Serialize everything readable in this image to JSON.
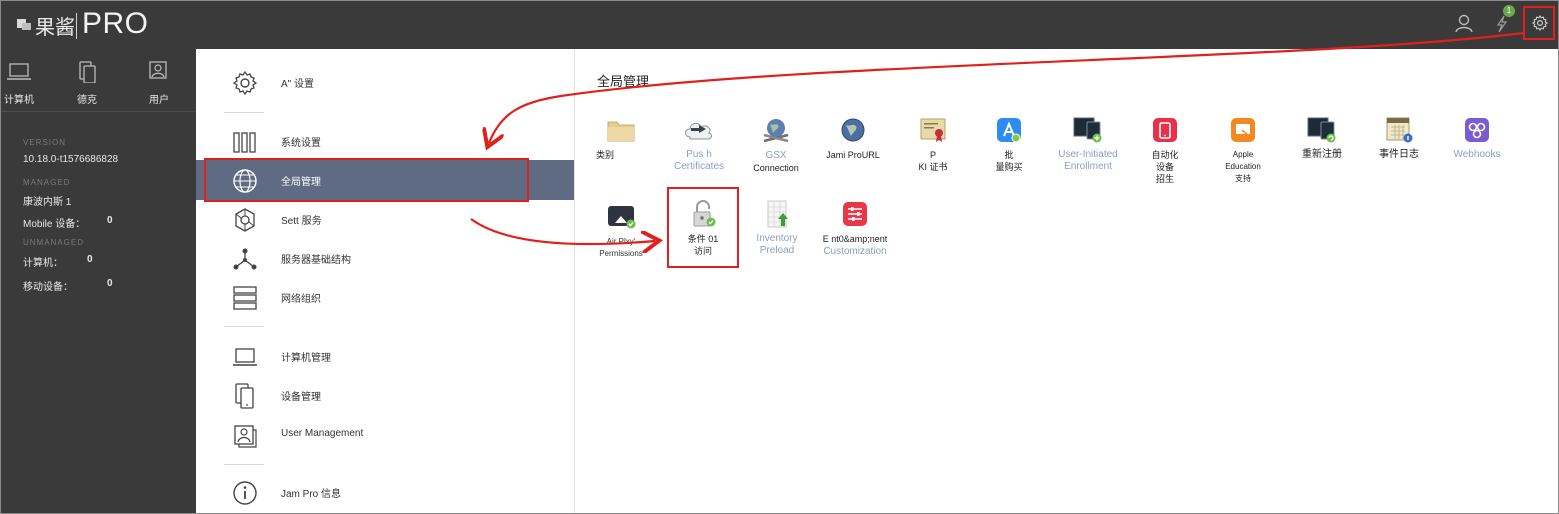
{
  "app": {
    "logo_cn": "果酱",
    "logo_pro": "PRO",
    "notification_count": "1"
  },
  "sidebar_nav": [
    {
      "label": "计算机",
      "icon": "laptop-icon"
    },
    {
      "label": "德克",
      "icon": "devices-icon"
    },
    {
      "label": "用户",
      "icon": "users-icon"
    }
  ],
  "status": {
    "version_label": "VERSION",
    "version": "10.18.0-t1576686828",
    "managed_label": "MANAGED",
    "managed_site": "康波内斯 1",
    "managed_mobile_label": "Mobile 设备：",
    "managed_mobile_count": "0",
    "unmanaged_label": "UNMANAGED",
    "unmanaged_computers_label": "计算机：",
    "unmanaged_computers_count": "0",
    "unmanaged_mobile_label": "移动设备：",
    "unmanaged_mobile_count": "0"
  },
  "menu": [
    {
      "label": "A\" 设置",
      "icon": "gear-icon"
    },
    {
      "label": "系统设置",
      "icon": "system-bars-icon"
    },
    {
      "label": "全局管理",
      "icon": "globe-icon"
    },
    {
      "label": "Sett 服务",
      "icon": "services-icon"
    },
    {
      "label": "服务器基础结构",
      "icon": "network-icon"
    },
    {
      "label": "网络组织",
      "icon": "server-stack-icon"
    },
    {
      "label": "计算机管理",
      "icon": "laptop-icon"
    },
    {
      "label": "设备管理",
      "icon": "mobile-devices-icon"
    },
    {
      "label": "User Management",
      "icon": "user-management-icon"
    },
    {
      "label": "Jam Pro 信息",
      "icon": "info-icon"
    }
  ],
  "content": {
    "title": "全局管理",
    "tiles_row1": [
      {
        "label": "类别",
        "icon": "folder-icon"
      },
      {
        "label": "Pus h\nCertificates",
        "icon": "cloud-push-icon"
      },
      {
        "label": "GSX\nConnection",
        "icon": "gsx-globe-icon"
      },
      {
        "label": "Jami ProURL",
        "icon": "globe-url-icon"
      },
      {
        "label": "P\nKI 证书",
        "icon": "certificate-icon"
      },
      {
        "label": "批\n量购买",
        "icon": "app-store-icon"
      },
      {
        "label": "User-Initiated\nEnrollment",
        "icon": "enrollment-icon"
      },
      {
        "label": "自动化\n设备\n招生",
        "icon": "auto-device-icon"
      },
      {
        "label": "Apple\nEducation\n支持",
        "icon": "apple-education-icon"
      },
      {
        "label": "重新注册",
        "icon": "re-enroll-icon"
      },
      {
        "label": "事件日志",
        "icon": "calendar-log-icon"
      },
      {
        "label": "Webhooks",
        "icon": "webhooks-icon"
      }
    ],
    "tiles_row2": [
      {
        "label": "Air Plxy'\nPermissions",
        "icon": "airplay-icon"
      },
      {
        "label": "条件 01\n访问",
        "icon": "conditional-access-lock-icon"
      },
      {
        "label": "Inventory\nPreload",
        "icon": "inventory-preload-icon"
      },
      {
        "label": "E nt0&amp;nent\nCustomization",
        "icon": "customization-icon"
      }
    ]
  },
  "colors": {
    "topbar": "#3a3a3a",
    "active_menu": "#5e6b82",
    "highlight": "#e0201d",
    "badge": "#6aa84f"
  }
}
